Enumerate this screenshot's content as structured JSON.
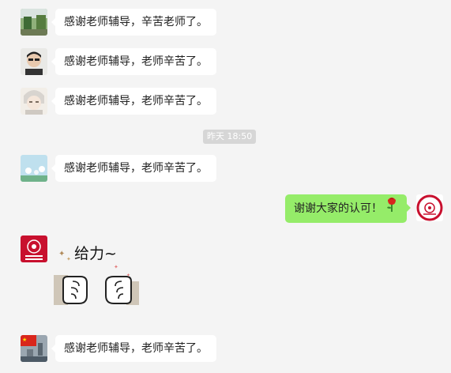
{
  "messages": [
    {
      "text": "感谢老师辅导，辛苦老师了。",
      "sender": "other"
    },
    {
      "text": "感谢老师辅导，老师辛苦了。",
      "sender": "other"
    },
    {
      "text": "感谢老师辅导，老师辛苦了。",
      "sender": "other"
    },
    {
      "text": "感谢老师辅导，老师辛苦了。",
      "sender": "other"
    },
    {
      "text": "谢谢大家的认可！",
      "sender": "me",
      "emoji": "rose-icon"
    },
    {
      "sticker": "gei-li-fist-bump",
      "sticker_text": "给力~",
      "sender": "other"
    },
    {
      "text": "感谢老师辅导，老师辛苦了。",
      "sender": "other"
    }
  ],
  "timestamp": "昨天 18:50",
  "colors": {
    "background": "#f4f4f4",
    "bubble_other": "#ffffff",
    "bubble_me": "#95ec69",
    "timestamp_bg": "#d6d6d6",
    "logo_red": "#c8102e"
  }
}
